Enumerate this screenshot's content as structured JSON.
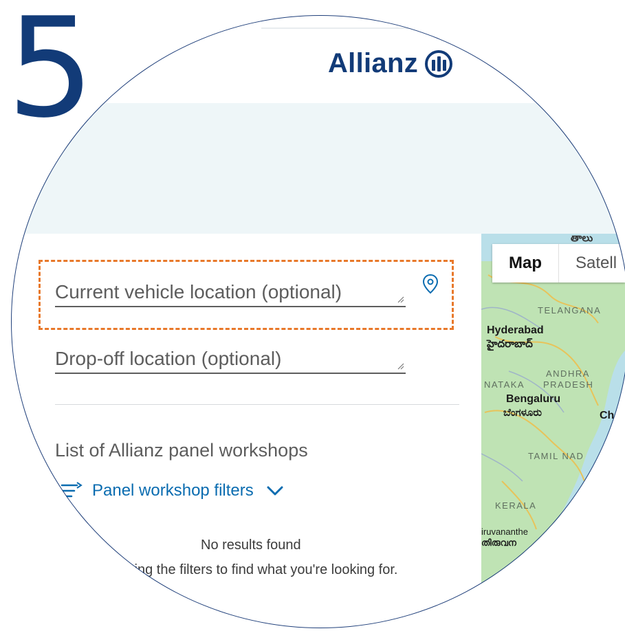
{
  "step_number": "5",
  "header": {
    "brand_name": "Allianz",
    "brand_color": "#123b78"
  },
  "form": {
    "current_location_placeholder": "Current vehicle location (optional)",
    "dropoff_placeholder": "Drop-off location (optional)",
    "location_icon": "map-pin-icon",
    "highlight_color": "#e8782a"
  },
  "workshops": {
    "title": "List of Allianz panel workshops",
    "filters_label": "Panel workshop filters",
    "no_results_title": "No results found",
    "no_results_hint": "ting the filters to find what you're looking for."
  },
  "map": {
    "tab_map": "Map",
    "tab_satellite": "Satell",
    "labels": {
      "top_native": "తాలు",
      "telangana": "TELANGANA",
      "hyderabad": "Hyderabad",
      "hyderabad_native": "హైదరాబాద్",
      "nataka": "NATAKA",
      "andhra": "ANDHRA",
      "pradesh": "PRADESH",
      "bengaluru": "Bengaluru",
      "bengaluru_native": "ಬೆಂಗಳೂರು",
      "chennai_partial": "Ch",
      "tamil_nadu": "TAMIL NAD",
      "kerala": "KERALA",
      "thiruvananthapuram": "iruvananthe",
      "thiruvananthapuram_native": "തിരുവന"
    }
  }
}
